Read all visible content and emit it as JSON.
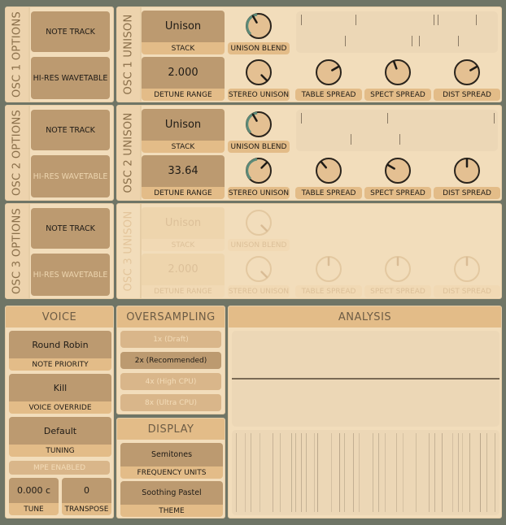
{
  "osc1_options": {
    "title": "OSC 1 OPTIONS",
    "note_track": "NOTE TRACK",
    "hires": "HI-RES WAVETABLE"
  },
  "osc2_options": {
    "title": "OSC 2 OPTIONS",
    "note_track": "NOTE TRACK",
    "hires": "HI-RES WAVETABLE"
  },
  "osc3_options": {
    "title": "OSC 3 OPTIONS",
    "note_track": "NOTE TRACK",
    "hires": "HI-RES WAVETABLE"
  },
  "osc1_unison": {
    "title": "OSC 1 UNISON",
    "stack_value": "Unison",
    "stack_label": "STACK",
    "detune_value": "2.000",
    "detune_label": "DETUNE RANGE",
    "unison_blend": "UNISON BLEND",
    "stereo_unison": "STEREO UNISON",
    "table_spread": "TABLE SPREAD",
    "spect_spread": "SPECT SPREAD",
    "dist_spread": "DIST SPREAD"
  },
  "osc2_unison": {
    "title": "OSC 2 UNISON",
    "stack_value": "Unison",
    "stack_label": "STACK",
    "detune_value": "33.64",
    "detune_label": "DETUNE RANGE",
    "unison_blend": "UNISON BLEND",
    "stereo_unison": "STEREO UNISON",
    "table_spread": "TABLE SPREAD",
    "spect_spread": "SPECT SPREAD",
    "dist_spread": "DIST SPREAD"
  },
  "osc3_unison": {
    "title": "OSC 3 UNISON",
    "stack_value": "Unison",
    "stack_label": "STACK",
    "detune_value": "2.000",
    "detune_label": "DETUNE RANGE",
    "unison_blend": "UNISON BLEND",
    "stereo_unison": "STEREO UNISON",
    "table_spread": "TABLE SPREAD",
    "spect_spread": "SPECT SPREAD",
    "dist_spread": "DIST SPREAD"
  },
  "voice": {
    "title": "VOICE",
    "note_priority_value": "Round Robin",
    "note_priority_label": "NOTE PRIORITY",
    "voice_override_value": "Kill",
    "voice_override_label": "VOICE OVERRIDE",
    "tuning_value": "Default",
    "tuning_label": "TUNING",
    "mpe": "MPE ENABLED",
    "tune_value": "0.000 c",
    "tune_label": "TUNE",
    "transpose_value": "0",
    "transpose_label": "TRANSPOSE"
  },
  "oversampling": {
    "title": "OVERSAMPLING",
    "options": [
      "1x (Draft)",
      "2x (Recommended)",
      "4x (High CPU)",
      "8x (Ultra CPU)"
    ],
    "selected_index": 1
  },
  "display": {
    "title": "DISPLAY",
    "freq_value": "Semitones",
    "freq_label": "FREQUENCY UNITS",
    "theme_value": "Soothing Pastel",
    "theme_label": "THEME"
  },
  "analysis": {
    "title": "ANALYSIS"
  },
  "colors": {
    "background": "#6f7566",
    "panel": "#f2ddbb",
    "button": "#bc9a70",
    "label": "#e3bc88",
    "accent": "#5c8a78"
  }
}
